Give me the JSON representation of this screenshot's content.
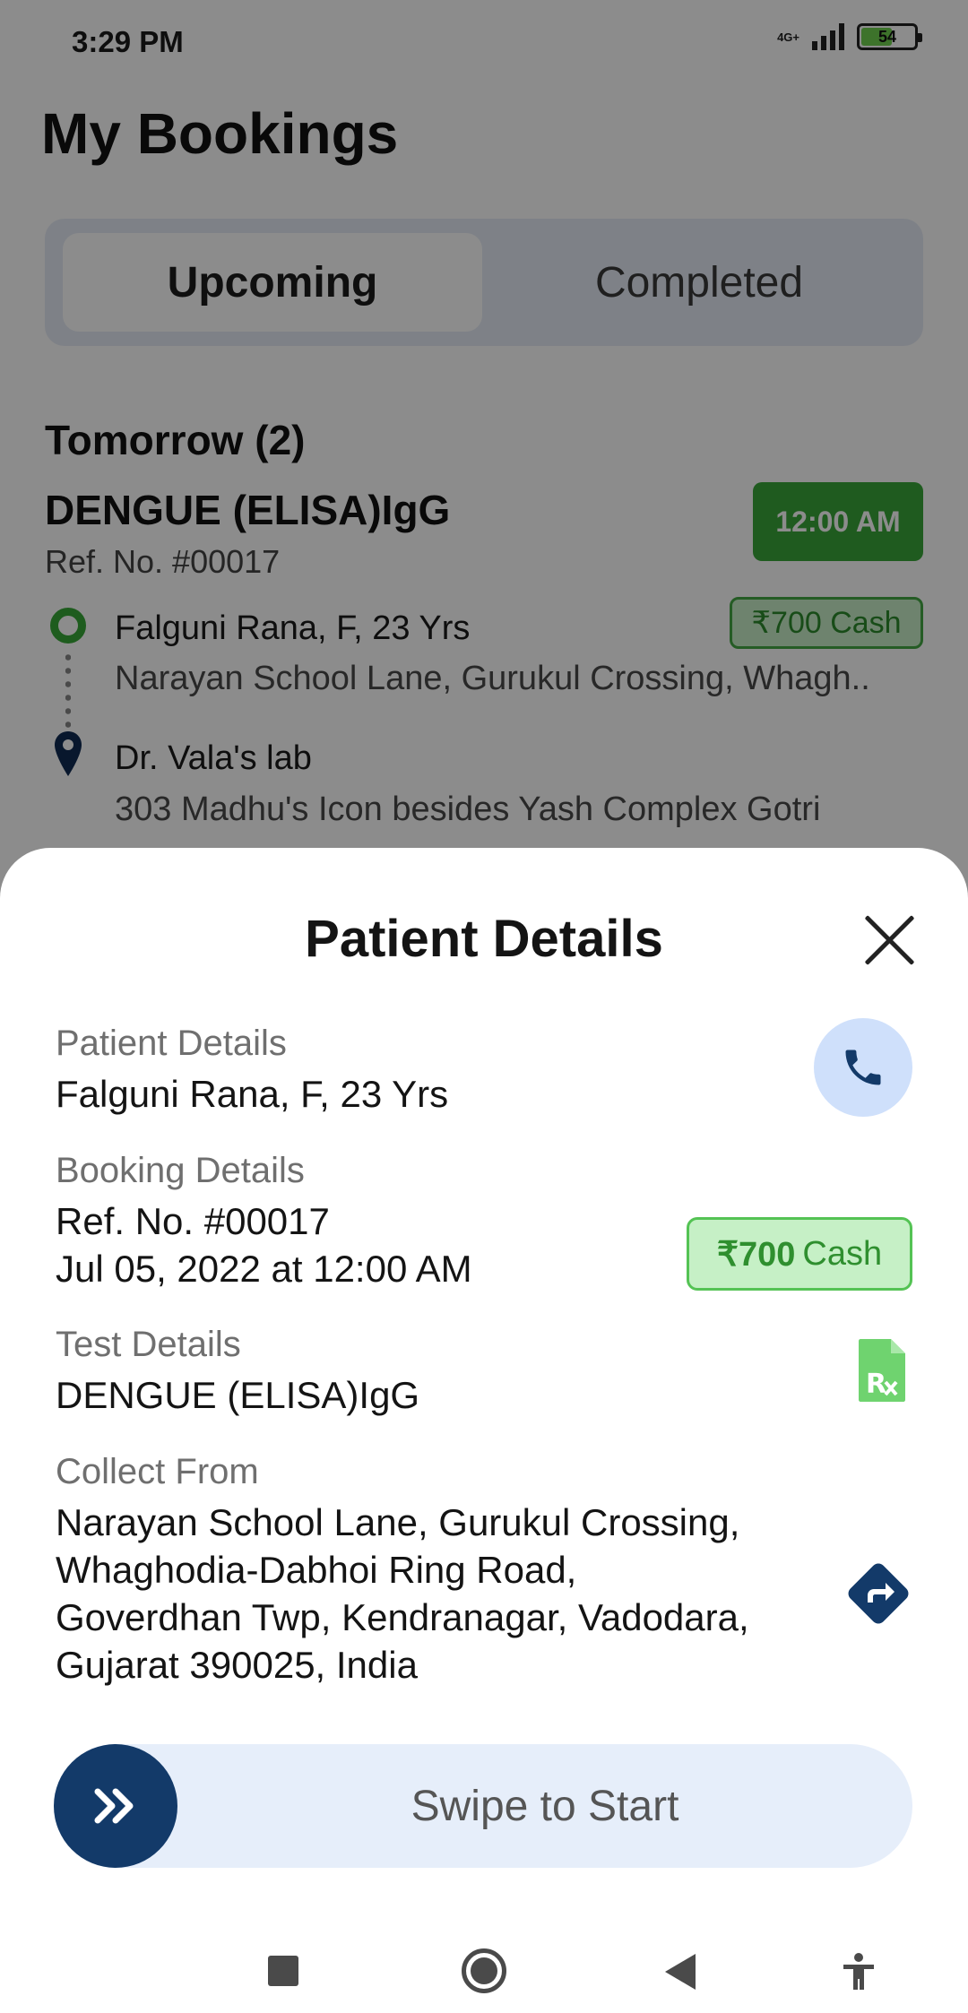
{
  "status_bar": {
    "time": "3:29 PM",
    "network": "4G+",
    "battery": "54"
  },
  "page": {
    "title": "My Bookings",
    "tabs": [
      {
        "label": "Upcoming",
        "selected": true
      },
      {
        "label": "Completed",
        "selected": false
      }
    ]
  },
  "booking_list": {
    "group_title": "Tomorrow (2)",
    "booking": {
      "test_name": "DENGUE (ELISA)IgG",
      "ref": "Ref. No. #00017",
      "time": "12:00 AM",
      "payment": "₹700 Cash",
      "patient": "Falguni Rana, F, 23 Yrs",
      "patient_address": "Narayan School Lane, Gurukul Crossing, Whagh..",
      "lab_name": "Dr. Vala's lab",
      "lab_address": "303 Madhu's Icon besides Yash Complex Gotri"
    }
  },
  "sheet": {
    "title": "Patient Details",
    "patient_label": "Patient Details",
    "patient_value": "Falguni Rana, F, 23 Yrs",
    "booking_label": "Booking Details",
    "booking_ref": "Ref. No. #00017",
    "booking_datetime": "Jul 05, 2022 at 12:00 AM",
    "payment_amount": "₹700",
    "payment_method": "Cash",
    "test_label": "Test Details",
    "test_value": "DENGUE (ELISA)IgG",
    "collect_label": "Collect From",
    "collect_lines": [
      "Narayan School Lane, Gurukul Crossing,",
      "Whaghodia-Dabhoi Ring Road,",
      "Goverdhan Twp, Kendranagar, Vadodara,",
      "Gujarat 390025, India"
    ],
    "swipe_label": "Swipe to Start"
  },
  "colors": {
    "accent_navy": "#133a69",
    "success_green": "#3aa63a",
    "cash_badge_bg": "#c6f0c6",
    "call_button_bg": "#cfe0fb"
  },
  "icons": {
    "call": "phone-icon",
    "close": "close-icon",
    "prescription": "prescription-icon",
    "directions": "directions-icon",
    "swipe": "double-chevron-right-icon"
  }
}
